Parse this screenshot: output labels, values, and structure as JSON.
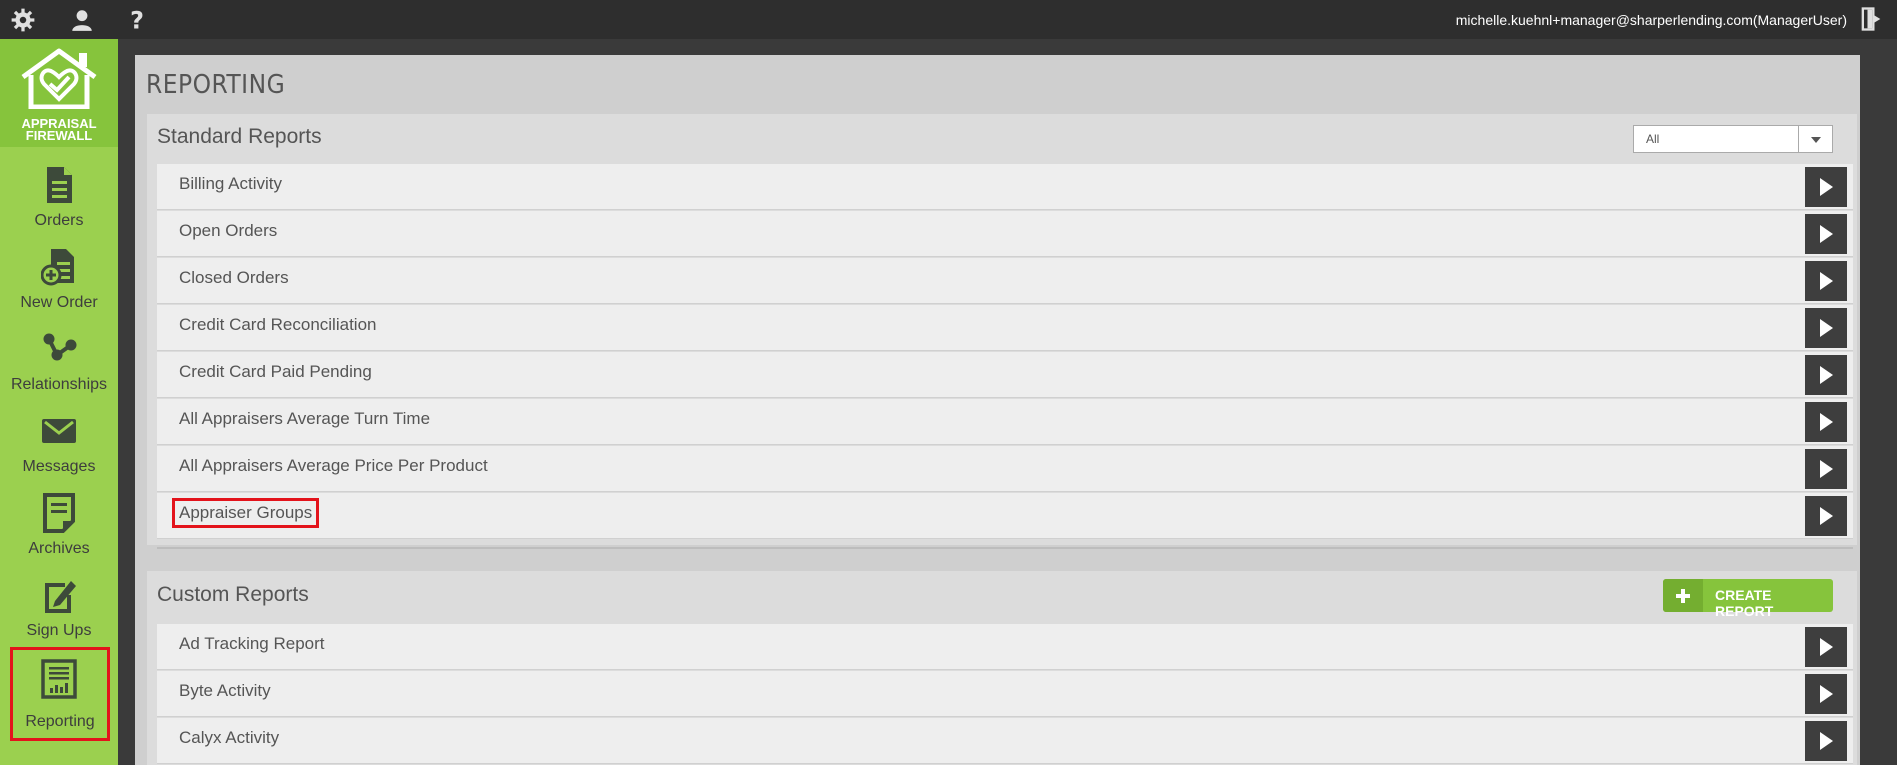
{
  "topbar": {
    "user_email": "michelle.kuehnl+manager@sharperlending.com(ManagerUser)",
    "icons": [
      "gear-icon",
      "user-icon",
      "help-icon",
      "logout-icon"
    ]
  },
  "logo": {
    "line1": "APPRAISAL",
    "line2": "FIREWALL"
  },
  "sidebar": {
    "items": [
      {
        "label": "Orders",
        "icon": "document-icon"
      },
      {
        "label": "New Order",
        "icon": "new-order-icon"
      },
      {
        "label": "Relationships",
        "icon": "share-icon"
      },
      {
        "label": "Messages",
        "icon": "envelope-icon"
      },
      {
        "label": "Archives",
        "icon": "archive-icon"
      },
      {
        "label": "Sign Ups",
        "icon": "edit-icon"
      },
      {
        "label": "Reporting",
        "icon": "report-icon"
      }
    ],
    "active": "Reporting"
  },
  "page": {
    "title": "REPORTING"
  },
  "standard_reports": {
    "title": "Standard Reports",
    "filter_value": "All",
    "rows": [
      "Billing Activity",
      "Open Orders",
      "Closed Orders",
      "Credit Card Reconciliation",
      "Credit Card Paid Pending",
      "All Appraisers Average Turn Time",
      "All Appraisers Average Price Per Product",
      "Appraiser Groups"
    ],
    "highlighted": "Appraiser Groups"
  },
  "custom_reports": {
    "title": "Custom Reports",
    "create_label": "CREATE REPORT",
    "rows": [
      "Ad Tracking Report",
      "Byte Activity",
      "Calyx Activity"
    ]
  },
  "colors": {
    "sidebar": "#9bd04f",
    "accent_green": "#86c43c",
    "highlight": "#e3131b",
    "topbar": "#2e2e2e"
  }
}
